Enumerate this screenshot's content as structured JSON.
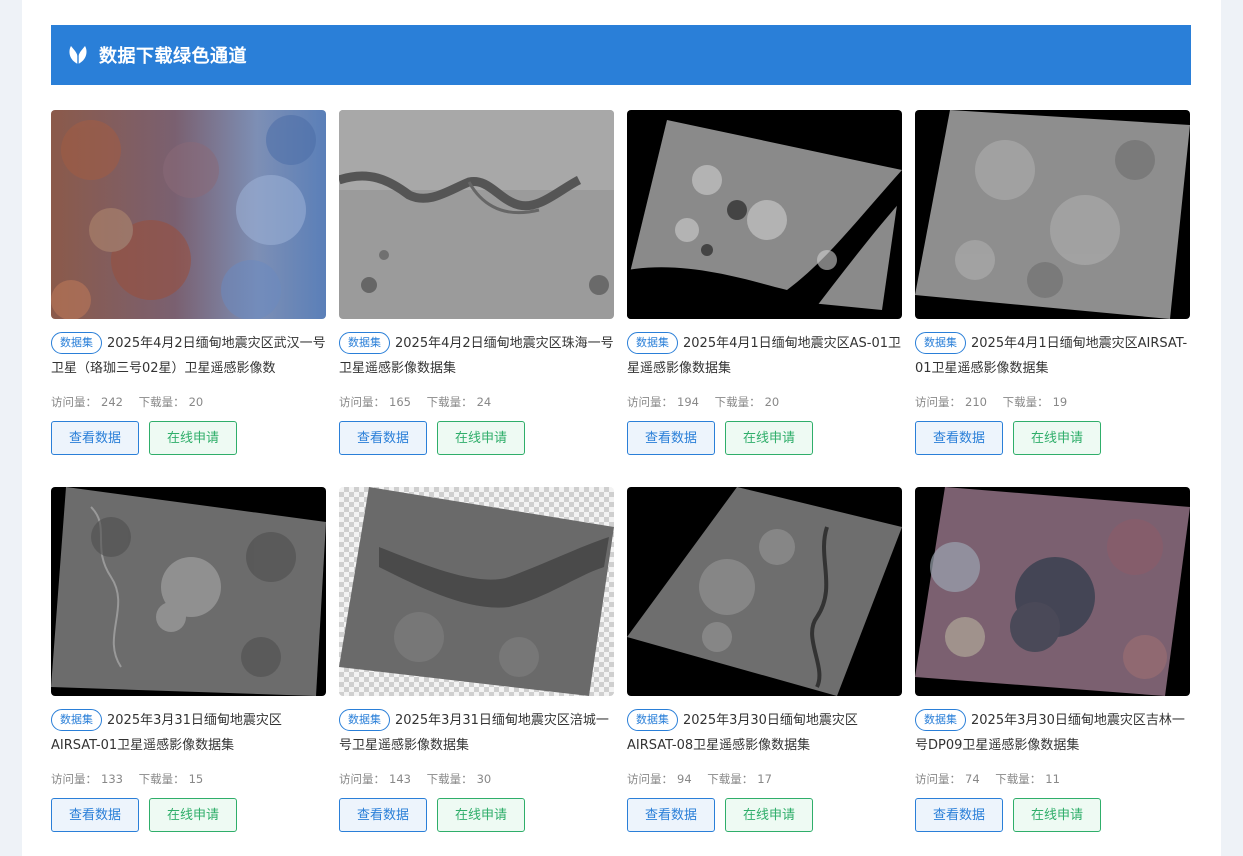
{
  "banner": {
    "title": "数据下载绿色通道",
    "icon": "leaf-icon",
    "color": "#2a7fd8"
  },
  "labels": {
    "tag": "数据集",
    "visits": "访问量：",
    "downloads": "下载量：",
    "view": "查看数据",
    "apply": "在线申请"
  },
  "cards": [
    {
      "title": "2025年4月2日缅甸地震灾区武汉一号卫星（珞珈三号02星）卫星遥感影像数",
      "visits": "242",
      "downloads": "20"
    },
    {
      "title": "2025年4月2日缅甸地震灾区珠海一号卫星遥感影像数据集",
      "visits": "165",
      "downloads": "24"
    },
    {
      "title": "2025年4月1日缅甸地震灾区AS-01卫星遥感影像数据集",
      "visits": "194",
      "downloads": "20"
    },
    {
      "title": "2025年4月1日缅甸地震灾区AIRSAT-01卫星遥感影像数据集",
      "visits": "210",
      "downloads": "19"
    },
    {
      "title": "2025年3月31日缅甸地震灾区AIRSAT-01卫星遥感影像数据集",
      "visits": "133",
      "downloads": "15"
    },
    {
      "title": "2025年3月31日缅甸地震灾区涪城一号卫星遥感影像数据集",
      "visits": "143",
      "downloads": "30"
    },
    {
      "title": "2025年3月30日缅甸地震灾区AIRSAT-08卫星遥感影像数据集",
      "visits": "94",
      "downloads": "17"
    },
    {
      "title": "2025年3月30日缅甸地震灾区吉林一号DP09卫星遥感影像数据集",
      "visits": "74",
      "downloads": "11"
    }
  ]
}
